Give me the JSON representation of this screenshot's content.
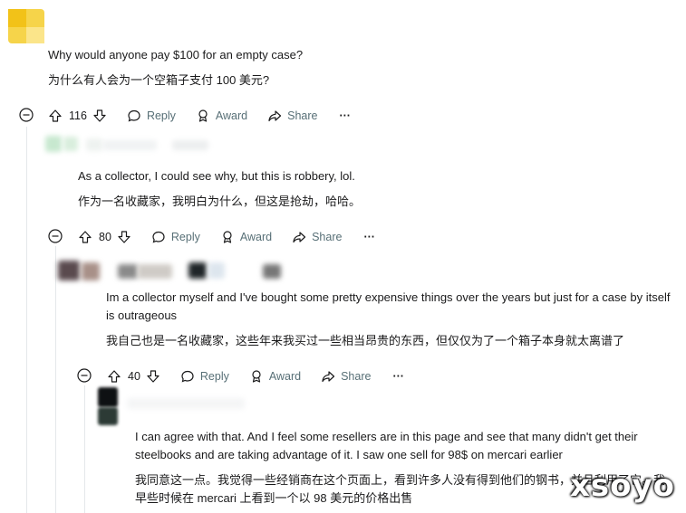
{
  "comments": [
    {
      "text_en": "Why would anyone pay $100 for an empty case?",
      "text_zh": "为什么有人会为一个空箱子支付 100 美元?",
      "votes": "116"
    },
    {
      "text_en": "As a collector, I could see why, but this is robbery, lol.",
      "text_zh": "作为一名收藏家，我明白为什么，但这是抢劫，哈哈。",
      "votes": "80"
    },
    {
      "text_en": "Im a collector myself and I've bought some pretty expensive things over the years but just for a case by itself is outrageous",
      "text_zh": "我自己也是一名收藏家，这些年来我买过一些相当昂贵的东西，但仅仅为了一个箱子本身就太离谱了",
      "votes": "40"
    },
    {
      "text_en": "I can agree with that. And I feel some resellers are in this page and see that many didn't get their steelbooks and are taking advantage of it. I saw one sell for 98$ on mercari earlier",
      "text_zh": "我同意这一点。我觉得一些经销商在这个页面上，看到许多人没有得到他们的钢书，并且利用了它。我早些时候在 mercari 上看到一个以 98 美元的价格出售"
    }
  ],
  "actions": {
    "reply": "Reply",
    "award": "Award",
    "share": "Share",
    "more": "···"
  },
  "watermark": "xsoyo",
  "colors": {
    "text": "#1a1a1b",
    "muted": "#576f76",
    "avatar_yellow": "#f2c218"
  }
}
